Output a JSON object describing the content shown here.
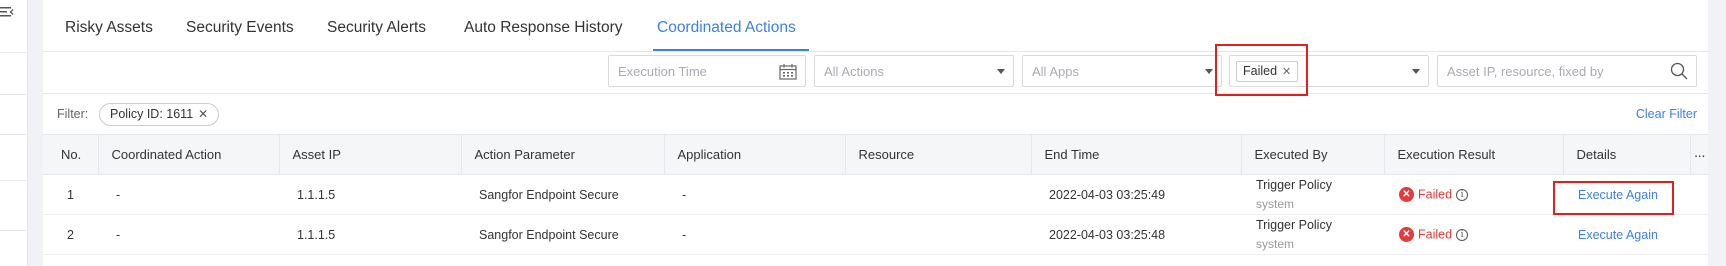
{
  "tabs": [
    {
      "label": "Risky Assets"
    },
    {
      "label": "Security Events"
    },
    {
      "label": "Security Alerts"
    },
    {
      "label": "Auto Response History"
    },
    {
      "label": "Coordinated Actions",
      "active": true
    }
  ],
  "filters": {
    "execution_time_placeholder": "Execution Time",
    "actions_select": "All Actions",
    "apps_select": "All Apps",
    "result_chip": "Failed",
    "search_placeholder": "Asset IP, resource, fixed by"
  },
  "active_filter": {
    "label": "Filter:",
    "pill": "Policy ID: 1611",
    "clear_label": "Clear Filter"
  },
  "table": {
    "columns": [
      "No.",
      "Coordinated Action",
      "Asset IP",
      "Action Parameter",
      "Application",
      "Resource",
      "End Time",
      "Executed By",
      "Execution Result",
      "Details"
    ],
    "more_label": "···",
    "rows": [
      {
        "no": "1",
        "action": "-",
        "ip": "1.1.1.5",
        "param": "Sangfor Endpoint Secure",
        "app": "-",
        "resource": "",
        "end_time": "2022-04-03 03:25:49",
        "executed_by": "Trigger Policy",
        "executed_by_sub": "system",
        "result": "Failed",
        "details": "Execute Again"
      },
      {
        "no": "2",
        "action": "-",
        "ip": "1.1.1.5",
        "param": "Sangfor Endpoint Secure",
        "app": "-",
        "resource": "",
        "end_time": "2022-04-03 03:25:48",
        "executed_by": "Trigger Policy",
        "executed_by_sub": "system",
        "result": "Failed",
        "details": "Execute Again"
      }
    ]
  },
  "icons": {
    "calendar": "calendar-icon",
    "search": "search-icon",
    "failed": "error-circle-icon",
    "info": "info-icon",
    "collapse": "collapse-menu-icon"
  },
  "colors": {
    "accent": "#3d7fe6",
    "error": "#e23b3b",
    "highlight_box": "#e02020"
  }
}
